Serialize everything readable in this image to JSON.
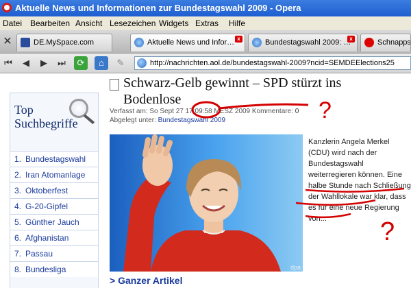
{
  "window": {
    "title": "Aktuelle News und Informationen zur Bundestagswahl 2009 - Opera"
  },
  "menu": [
    "Datei",
    "Bearbeiten",
    "Ansicht",
    "Lesezeichen",
    "Widgets",
    "Extras",
    "Hilfe"
  ],
  "tabs": [
    {
      "label": "DE.MySpace.com"
    },
    {
      "label": "Aktuelle News und Infor…"
    },
    {
      "label": "Bundestagswahl 2009: …"
    },
    {
      "label": "Schnappsc"
    }
  ],
  "address": {
    "url": "http://nachrichten.aol.de/bundestagswahl-2009?ncid=SEMDEElections25"
  },
  "sidebar": {
    "heading_line1": "Top",
    "heading_line2": "Suchbegriffe",
    "items": [
      {
        "num": "1.",
        "name": "Bundestagswahl"
      },
      {
        "num": "2.",
        "name": "Iran Atomanlage"
      },
      {
        "num": "3.",
        "name": "Oktoberfest"
      },
      {
        "num": "4.",
        "name": "G-20-Gipfel"
      },
      {
        "num": "5.",
        "name": "Günther Jauch"
      },
      {
        "num": "6.",
        "name": "Afghanistan"
      },
      {
        "num": "7.",
        "name": "Passau"
      },
      {
        "num": "8.",
        "name": "Bundesliga"
      }
    ]
  },
  "article": {
    "headline": "Schwarz-Gelb gewinnt – SPD stürzt ins Bodenlose",
    "meta_prefix": "Verfasst am: So Sept 27 17:09:58 MESZ 2009 Kommentare:",
    "comments": "0",
    "filed_label": "Abgelegt unter:",
    "filed_link": "Bundestagswahl 2009",
    "photo_credit": "dpa",
    "body": "Kanzlerin Angela Merkel (CDU) wird nach der Bundestagswahl weiterregieren können. Eine halbe Stunde nach Schließung der Wahllokale war klar, dass es für eine neue Regierung von...",
    "more_link": "> Ganzer Artikel"
  },
  "annotations": {
    "question_marks": [
      "?",
      "?"
    ],
    "color": "#d40000"
  },
  "colors": {
    "titlebar": "#1e5ed0",
    "link": "#1a3b9c",
    "tab_close": "#dd0000"
  }
}
